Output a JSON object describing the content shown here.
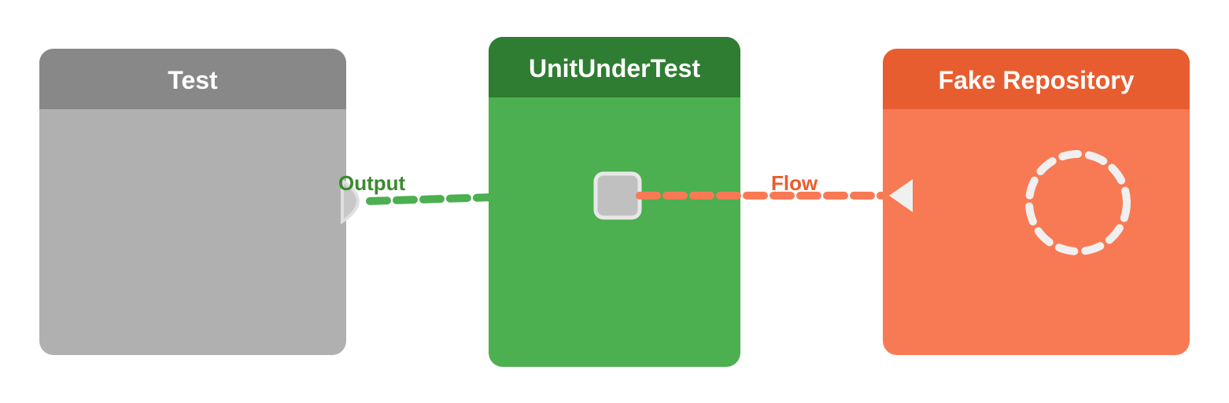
{
  "boxes": {
    "test": {
      "title": "Test",
      "header_bg": "#888888",
      "body_bg": "#b0b0b0"
    },
    "unit": {
      "title": "UnitUnderTest",
      "header_bg": "#2e7d32",
      "body_bg": "#4caf50"
    },
    "fake": {
      "title": "Fake Repository",
      "header_bg": "#e85d2f",
      "body_bg": "#f87a55"
    }
  },
  "labels": {
    "output": "Output",
    "flow": "Flow"
  },
  "colors": {
    "green_line": "#4caf50",
    "orange_line": "#f87a55",
    "white": "#ffffff",
    "port_bg": "#c8c8c8",
    "port_border": "#e0e0e0"
  }
}
